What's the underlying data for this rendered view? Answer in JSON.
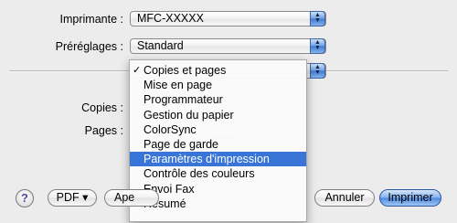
{
  "printer": {
    "label": "Imprimante :",
    "value": "MFC-XXXXX"
  },
  "presets": {
    "label": "Préréglages :",
    "value": "Standard"
  },
  "copies": {
    "label": "Copies :"
  },
  "pages": {
    "label": "Pages :"
  },
  "panel_menu": {
    "items": [
      {
        "label": "Copies et pages",
        "checked": true
      },
      {
        "label": "Mise en page"
      },
      {
        "label": "Programmateur"
      },
      {
        "label": "Gestion du papier"
      },
      {
        "label": "ColorSync"
      },
      {
        "label": "Page de garde"
      },
      {
        "label": "Paramètres d'impression",
        "selected": true
      },
      {
        "label": "Contrôle des couleurs"
      },
      {
        "label": "Envoi Fax"
      },
      {
        "label": "Résumé"
      }
    ]
  },
  "footer": {
    "help_label": "?",
    "pdf_label": "PDF ▾",
    "preview_label": "Ape",
    "cancel_label": "Annuler",
    "print_label": "Imprimer"
  },
  "colors": {
    "selection": "#3875d7",
    "default_button": "#4b88dd"
  },
  "icons": {
    "check": "checkmark-icon",
    "stepper": "up-down-arrows-icon",
    "help": "question-mark-icon"
  }
}
